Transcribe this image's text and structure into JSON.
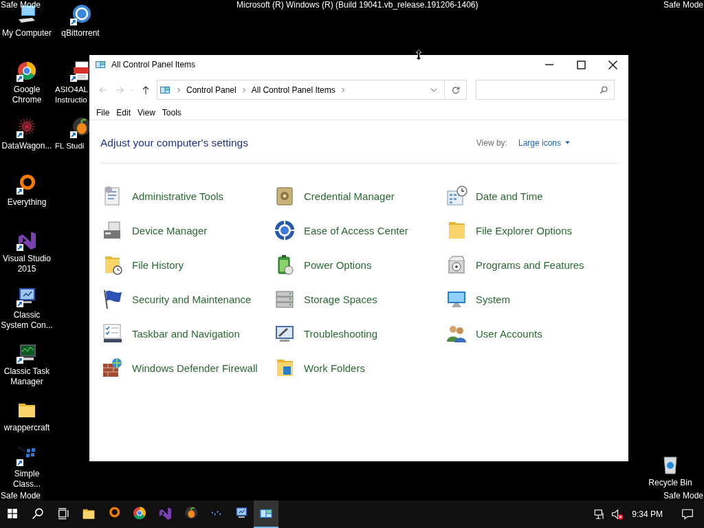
{
  "banner": {
    "top_left": "Safe Mode",
    "top_center": "Microsoft (R) Windows (R) (Build 19041.vb_release.191206-1406)",
    "top_right": "Safe Mode",
    "bottom_left": "Safe Mode",
    "bottom_right": "Safe Mode"
  },
  "desktop_icons": [
    {
      "label": "My Computer",
      "kind": "computer"
    },
    {
      "label": "qBittorrent",
      "kind": "torrent"
    },
    {
      "label": "Google Chrome",
      "kind": "chrome"
    },
    {
      "label": "ASIO4AL Instructio",
      "kind": "pdf"
    },
    {
      "label": "DataWagon...",
      "kind": "starburst"
    },
    {
      "label": "FL Studi",
      "kind": "fruit"
    },
    {
      "label": "Everything",
      "kind": "ring"
    },
    {
      "label": "Visual Studio 2015",
      "kind": "vs"
    },
    {
      "label": "Classic System Con...",
      "kind": "monitor"
    },
    {
      "label": "Classic Task Manager",
      "kind": "taskmgr"
    },
    {
      "label": "wrappercraft",
      "kind": "folder"
    },
    {
      "label": "Simple Class...",
      "kind": "tiles"
    },
    {
      "label": "Recycle Bin",
      "kind": "bin"
    }
  ],
  "window": {
    "title": "All Control Panel Items",
    "nav": {
      "back": {
        "disabled": true
      },
      "forward": {
        "disabled": true
      },
      "up": {
        "disabled": false
      }
    },
    "breadcrumb": [
      "Control Panel",
      "All Control Panel Items"
    ],
    "menu": [
      "File",
      "Edit",
      "View",
      "Tools"
    ],
    "heading": "Adjust your computer's settings",
    "view_by_label": "View by:",
    "view_by_value": "Large icons",
    "items": [
      {
        "label": "Administrative Tools",
        "kind": "tools"
      },
      {
        "label": "Credential Manager",
        "kind": "safe"
      },
      {
        "label": "Date and Time",
        "kind": "calendar"
      },
      {
        "label": "Device Manager",
        "kind": "printer"
      },
      {
        "label": "Ease of Access Center",
        "kind": "access"
      },
      {
        "label": "File Explorer Options",
        "kind": "folder"
      },
      {
        "label": "File History",
        "kind": "folder-clock"
      },
      {
        "label": "Power Options",
        "kind": "battery"
      },
      {
        "label": "Programs and Features",
        "kind": "box"
      },
      {
        "label": "Security and Maintenance",
        "kind": "flag"
      },
      {
        "label": "Storage Spaces",
        "kind": "disks"
      },
      {
        "label": "System",
        "kind": "monitor"
      },
      {
        "label": "Taskbar and Navigation",
        "kind": "taskbar"
      },
      {
        "label": "Troubleshooting",
        "kind": "monitor-tool"
      },
      {
        "label": "User Accounts",
        "kind": "users"
      },
      {
        "label": "Windows Defender Firewall",
        "kind": "wall"
      },
      {
        "label": "Work Folders",
        "kind": "folder-blue"
      }
    ]
  },
  "taskbar": {
    "apps": [
      {
        "kind": "start",
        "selected": false
      },
      {
        "kind": "search",
        "selected": false
      },
      {
        "kind": "taskview",
        "selected": false
      },
      {
        "kind": "folder",
        "selected": false
      },
      {
        "kind": "ring",
        "selected": false
      },
      {
        "kind": "chrome",
        "selected": false
      },
      {
        "kind": "vs",
        "selected": false
      },
      {
        "kind": "fruit",
        "selected": false
      },
      {
        "kind": "dots",
        "selected": false
      },
      {
        "kind": "monitor",
        "selected": false
      },
      {
        "kind": "cpl",
        "selected": true
      }
    ],
    "volume": {
      "muted": true
    },
    "clock": "9:34 PM"
  }
}
